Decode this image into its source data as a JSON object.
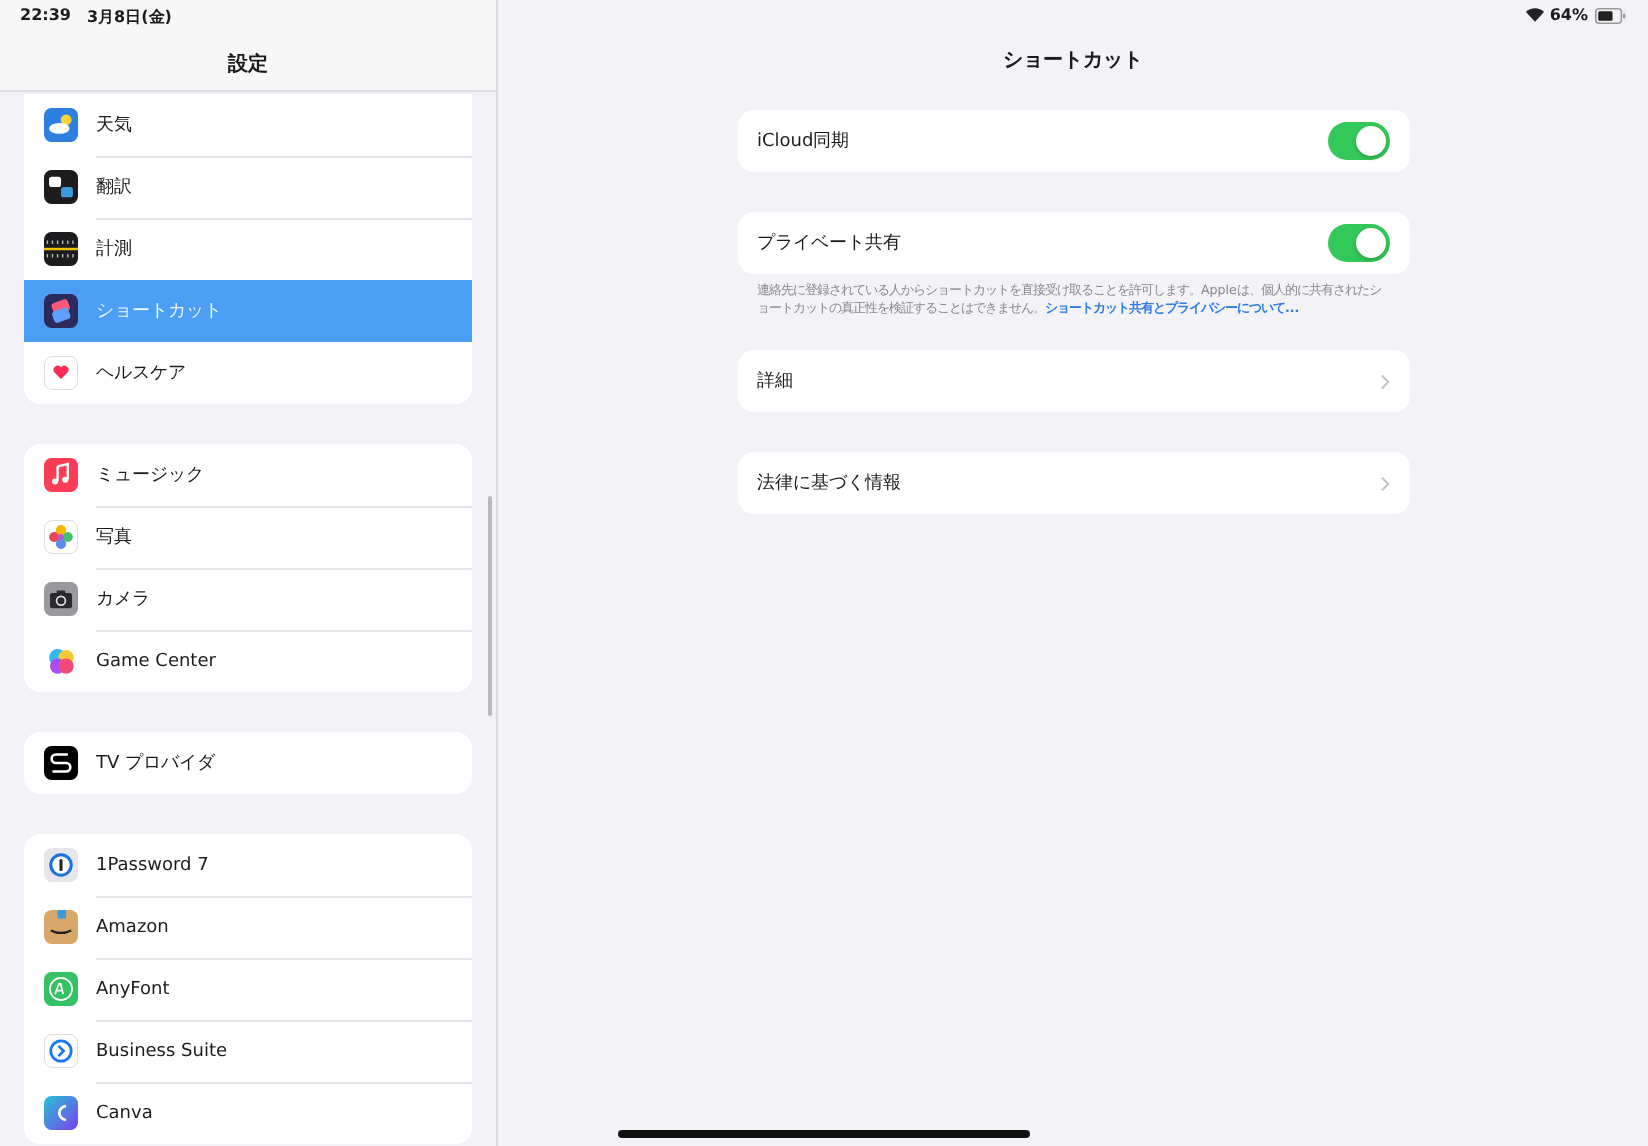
{
  "status_bar": {
    "time": "22:39",
    "date": "3月8日(金)",
    "battery": "64%"
  },
  "sidebar": {
    "title": "設定",
    "groups": [
      {
        "items": [
          {
            "label": "天気",
            "selected": false
          },
          {
            "label": "翻訳",
            "selected": false
          },
          {
            "label": "計測",
            "selected": false
          },
          {
            "label": "ショートカット",
            "selected": true
          },
          {
            "label": "ヘルスケア",
            "selected": false
          }
        ]
      },
      {
        "items": [
          {
            "label": "ミュージック",
            "selected": false
          },
          {
            "label": "写真",
            "selected": false
          },
          {
            "label": "カメラ",
            "selected": false
          },
          {
            "label": "Game Center",
            "selected": false
          }
        ]
      },
      {
        "items": [
          {
            "label": "TV プロバイダ",
            "selected": false
          }
        ]
      },
      {
        "items": [
          {
            "label": "1Password 7",
            "selected": false
          },
          {
            "label": "Amazon",
            "selected": false
          },
          {
            "label": "AnyFont",
            "selected": false
          },
          {
            "label": "Business Suite",
            "selected": false
          },
          {
            "label": "Canva",
            "selected": false
          }
        ]
      }
    ]
  },
  "detail": {
    "title": "ショートカット",
    "sections": [
      {
        "kind": "toggle",
        "label": "iCloud同期",
        "on": true
      },
      {
        "kind": "toggle",
        "label": "プライベート共有",
        "on": true,
        "footer": "連絡先に登録されている人からショートカットを直接受け取ることを許可します。Appleは、個人的に共有されたショートカットの真正性を検証することはできません。",
        "footer_link": "ショートカット共有とプライバシーについて..."
      },
      {
        "kind": "link",
        "label": "詳細"
      },
      {
        "kind": "link",
        "label": "法律に基づく情報"
      }
    ]
  }
}
